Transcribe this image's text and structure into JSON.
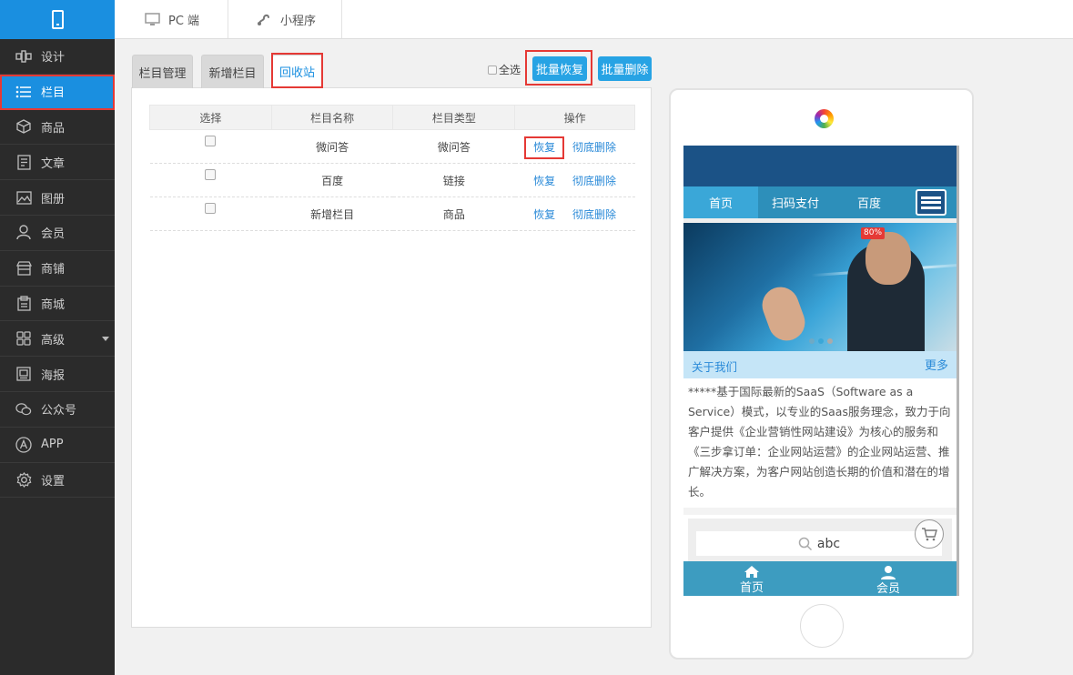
{
  "topbar": {
    "tabs": [
      {
        "label": "PC 端",
        "icon": "monitor-icon"
      },
      {
        "label": "小程序",
        "icon": "mini-program-icon"
      }
    ]
  },
  "sidebar": {
    "logo_icon": "phone-icon",
    "items": [
      {
        "label": "设计",
        "icon": "design-icon"
      },
      {
        "label": "栏目",
        "icon": "list-icon",
        "active": true
      },
      {
        "label": "商品",
        "icon": "box-icon"
      },
      {
        "label": "文章",
        "icon": "article-icon"
      },
      {
        "label": "图册",
        "icon": "album-icon"
      },
      {
        "label": "会员",
        "icon": "user-icon"
      },
      {
        "label": "商铺",
        "icon": "store-icon"
      },
      {
        "label": "商城",
        "icon": "mall-icon"
      },
      {
        "label": "高级",
        "icon": "grid-icon",
        "has_dropdown": true
      },
      {
        "label": "海报",
        "icon": "poster-icon"
      },
      {
        "label": "公众号",
        "icon": "wechat-icon"
      },
      {
        "label": "APP",
        "icon": "app-icon"
      },
      {
        "label": "设置",
        "icon": "gear-icon"
      }
    ]
  },
  "main": {
    "tabs": [
      {
        "label": "栏目管理"
      },
      {
        "label": "新增栏目"
      },
      {
        "label": "回收站",
        "active": true
      }
    ],
    "select_all_label": "全选",
    "batch_restore_label": "批量恢复",
    "batch_delete_label": "批量删除",
    "table": {
      "headers": [
        "选择",
        "栏目名称",
        "栏目类型",
        "操作"
      ],
      "rows": [
        {
          "name": "微问答",
          "type": "微问答",
          "restore": "恢复",
          "delete": "彻底删除"
        },
        {
          "name": "百度",
          "type": "链接",
          "restore": "恢复",
          "delete": "彻底删除"
        },
        {
          "name": "新增栏目",
          "type": "商品",
          "restore": "恢复",
          "delete": "彻底删除"
        }
      ]
    }
  },
  "preview": {
    "nav": [
      "首页",
      "扫码支付",
      "百度"
    ],
    "banner_badge": "80%",
    "about_title": "关于我们",
    "about_more": "更多",
    "about_text": "*****基于国际最新的SaaS（Software as a Service）模式，以专业的Saas服务理念，致力于向客户提供《企业营销性网站建设》为核心的服务和《三步拿订单：企业网站运营》的企业网站运营、推广解决方案，为客户网站创造长期的价值和潜在的增长。",
    "search_placeholder": "abc",
    "bottom_nav": [
      "首页",
      "会员"
    ]
  },
  "colors": {
    "accent": "#1a8fe0",
    "highlight": "#e53935",
    "sidebar_bg": "#2b2b2b"
  }
}
